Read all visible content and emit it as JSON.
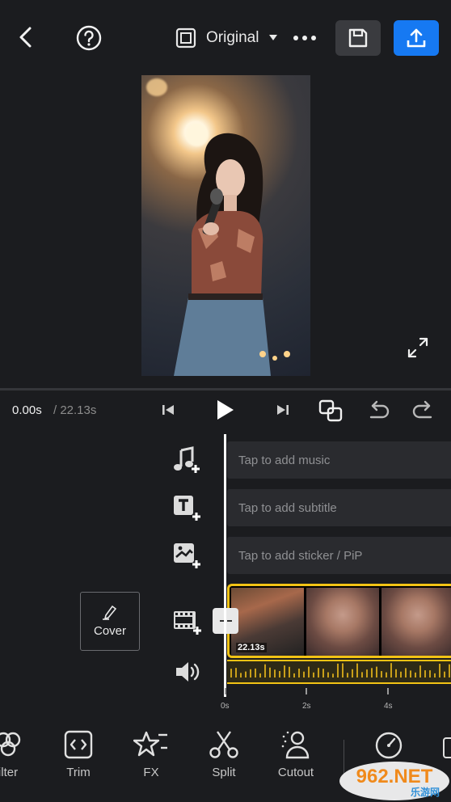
{
  "header": {
    "back_icon": "chevron-left-icon",
    "help_icon": "question-circle-icon",
    "aspect_icon": "aspect-frame-icon",
    "aspect_label": "Original",
    "aspect_dropdown_icon": "caret-down-icon",
    "more_icon": "more-horizontal-icon",
    "save_icon": "floppy-disk-icon",
    "export_icon": "upload-icon"
  },
  "preview": {
    "fullscreen_icon": "expand-icon"
  },
  "playback": {
    "current_time": "0.00s",
    "total_time": "/ 22.13s",
    "prev_icon": "skip-previous-icon",
    "play_icon": "play-icon",
    "next_icon": "skip-next-icon",
    "copy_icon": "duplicate-icon",
    "undo_icon": "undo-icon",
    "redo_icon": "redo-icon"
  },
  "tracks": {
    "music_placeholder": "Tap to add music",
    "subtitle_placeholder": "Tap to add subtitle",
    "sticker_placeholder": "Tap to add sticker / PiP",
    "cover_label": "Cover",
    "clip_duration": "22.13s"
  },
  "ruler": {
    "ticks": [
      "0s",
      "2s",
      "4s"
    ]
  },
  "toolbar": {
    "items": [
      {
        "label": "ilter",
        "icon": "filter-icon"
      },
      {
        "label": "Trim",
        "icon": "trim-icon"
      },
      {
        "label": "FX",
        "icon": "fx-star-icon"
      },
      {
        "label": "Split",
        "icon": "scissors-icon"
      },
      {
        "label": "Cutout",
        "icon": "cutout-person-icon"
      },
      {
        "label": "",
        "icon": "speed-gauge-icon"
      }
    ]
  },
  "watermark": {
    "text_main": "962.NET",
    "text_sub": "乐游网"
  },
  "colors": {
    "accent_blue": "#1679f2",
    "clip_yellow": "#f2c315",
    "background": "#1b1c1f"
  }
}
